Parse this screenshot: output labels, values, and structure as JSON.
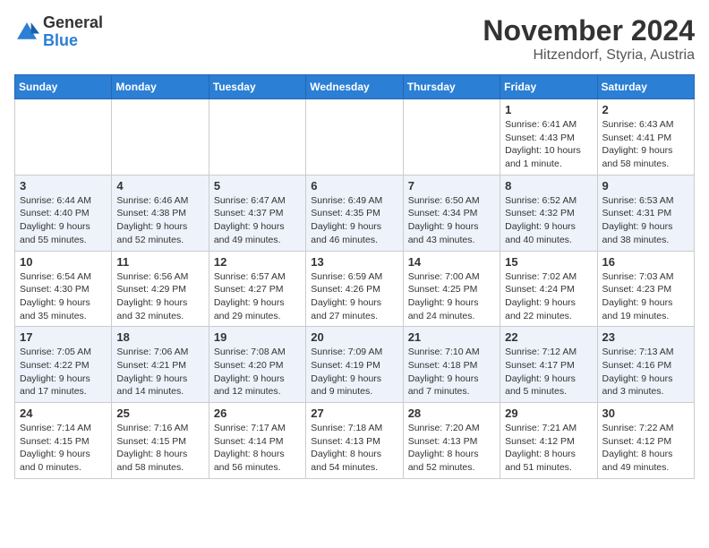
{
  "header": {
    "logo_general": "General",
    "logo_blue": "Blue",
    "month": "November 2024",
    "location": "Hitzendorf, Styria, Austria"
  },
  "weekdays": [
    "Sunday",
    "Monday",
    "Tuesday",
    "Wednesday",
    "Thursday",
    "Friday",
    "Saturday"
  ],
  "weeks": [
    [
      {
        "day": "",
        "info": ""
      },
      {
        "day": "",
        "info": ""
      },
      {
        "day": "",
        "info": ""
      },
      {
        "day": "",
        "info": ""
      },
      {
        "day": "",
        "info": ""
      },
      {
        "day": "1",
        "info": "Sunrise: 6:41 AM\nSunset: 4:43 PM\nDaylight: 10 hours\nand 1 minute."
      },
      {
        "day": "2",
        "info": "Sunrise: 6:43 AM\nSunset: 4:41 PM\nDaylight: 9 hours\nand 58 minutes."
      }
    ],
    [
      {
        "day": "3",
        "info": "Sunrise: 6:44 AM\nSunset: 4:40 PM\nDaylight: 9 hours\nand 55 minutes."
      },
      {
        "day": "4",
        "info": "Sunrise: 6:46 AM\nSunset: 4:38 PM\nDaylight: 9 hours\nand 52 minutes."
      },
      {
        "day": "5",
        "info": "Sunrise: 6:47 AM\nSunset: 4:37 PM\nDaylight: 9 hours\nand 49 minutes."
      },
      {
        "day": "6",
        "info": "Sunrise: 6:49 AM\nSunset: 4:35 PM\nDaylight: 9 hours\nand 46 minutes."
      },
      {
        "day": "7",
        "info": "Sunrise: 6:50 AM\nSunset: 4:34 PM\nDaylight: 9 hours\nand 43 minutes."
      },
      {
        "day": "8",
        "info": "Sunrise: 6:52 AM\nSunset: 4:32 PM\nDaylight: 9 hours\nand 40 minutes."
      },
      {
        "day": "9",
        "info": "Sunrise: 6:53 AM\nSunset: 4:31 PM\nDaylight: 9 hours\nand 38 minutes."
      }
    ],
    [
      {
        "day": "10",
        "info": "Sunrise: 6:54 AM\nSunset: 4:30 PM\nDaylight: 9 hours\nand 35 minutes."
      },
      {
        "day": "11",
        "info": "Sunrise: 6:56 AM\nSunset: 4:29 PM\nDaylight: 9 hours\nand 32 minutes."
      },
      {
        "day": "12",
        "info": "Sunrise: 6:57 AM\nSunset: 4:27 PM\nDaylight: 9 hours\nand 29 minutes."
      },
      {
        "day": "13",
        "info": "Sunrise: 6:59 AM\nSunset: 4:26 PM\nDaylight: 9 hours\nand 27 minutes."
      },
      {
        "day": "14",
        "info": "Sunrise: 7:00 AM\nSunset: 4:25 PM\nDaylight: 9 hours\nand 24 minutes."
      },
      {
        "day": "15",
        "info": "Sunrise: 7:02 AM\nSunset: 4:24 PM\nDaylight: 9 hours\nand 22 minutes."
      },
      {
        "day": "16",
        "info": "Sunrise: 7:03 AM\nSunset: 4:23 PM\nDaylight: 9 hours\nand 19 minutes."
      }
    ],
    [
      {
        "day": "17",
        "info": "Sunrise: 7:05 AM\nSunset: 4:22 PM\nDaylight: 9 hours\nand 17 minutes."
      },
      {
        "day": "18",
        "info": "Sunrise: 7:06 AM\nSunset: 4:21 PM\nDaylight: 9 hours\nand 14 minutes."
      },
      {
        "day": "19",
        "info": "Sunrise: 7:08 AM\nSunset: 4:20 PM\nDaylight: 9 hours\nand 12 minutes."
      },
      {
        "day": "20",
        "info": "Sunrise: 7:09 AM\nSunset: 4:19 PM\nDaylight: 9 hours\nand 9 minutes."
      },
      {
        "day": "21",
        "info": "Sunrise: 7:10 AM\nSunset: 4:18 PM\nDaylight: 9 hours\nand 7 minutes."
      },
      {
        "day": "22",
        "info": "Sunrise: 7:12 AM\nSunset: 4:17 PM\nDaylight: 9 hours\nand 5 minutes."
      },
      {
        "day": "23",
        "info": "Sunrise: 7:13 AM\nSunset: 4:16 PM\nDaylight: 9 hours\nand 3 minutes."
      }
    ],
    [
      {
        "day": "24",
        "info": "Sunrise: 7:14 AM\nSunset: 4:15 PM\nDaylight: 9 hours\nand 0 minutes."
      },
      {
        "day": "25",
        "info": "Sunrise: 7:16 AM\nSunset: 4:15 PM\nDaylight: 8 hours\nand 58 minutes."
      },
      {
        "day": "26",
        "info": "Sunrise: 7:17 AM\nSunset: 4:14 PM\nDaylight: 8 hours\nand 56 minutes."
      },
      {
        "day": "27",
        "info": "Sunrise: 7:18 AM\nSunset: 4:13 PM\nDaylight: 8 hours\nand 54 minutes."
      },
      {
        "day": "28",
        "info": "Sunrise: 7:20 AM\nSunset: 4:13 PM\nDaylight: 8 hours\nand 52 minutes."
      },
      {
        "day": "29",
        "info": "Sunrise: 7:21 AM\nSunset: 4:12 PM\nDaylight: 8 hours\nand 51 minutes."
      },
      {
        "day": "30",
        "info": "Sunrise: 7:22 AM\nSunset: 4:12 PM\nDaylight: 8 hours\nand 49 minutes."
      }
    ]
  ]
}
